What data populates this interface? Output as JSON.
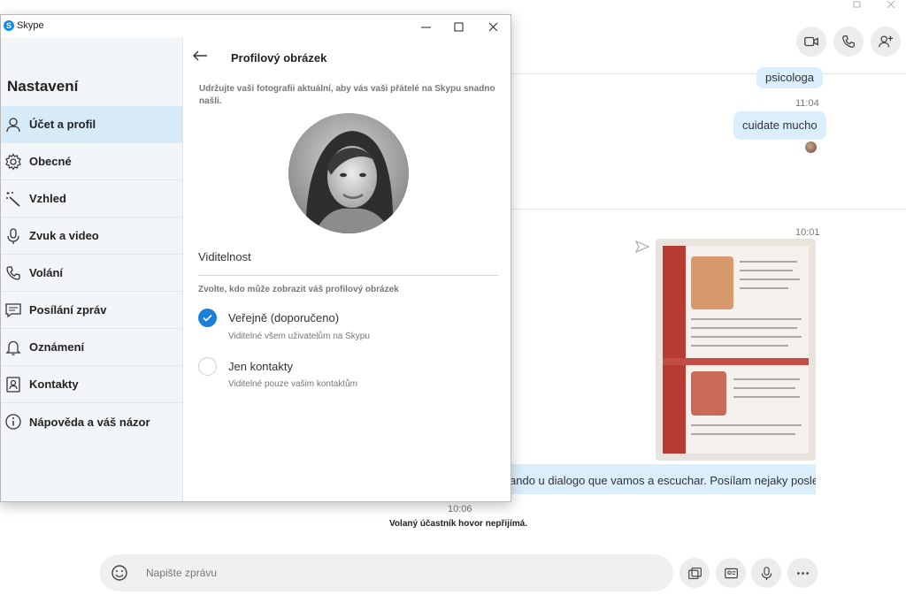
{
  "window": {
    "title": "Skype",
    "logo_letter": "S"
  },
  "settings": {
    "heading": "Nastavení",
    "nav": [
      {
        "label": "Účet a profil",
        "icon": "person-icon",
        "selected": true
      },
      {
        "label": "Obecné",
        "icon": "gear-icon",
        "selected": false
      },
      {
        "label": "Vzhled",
        "icon": "magic-wand-icon",
        "selected": false
      },
      {
        "label": "Zvuk a video",
        "icon": "microphone-icon",
        "selected": false
      },
      {
        "label": "Volání",
        "icon": "phone-icon",
        "selected": false
      },
      {
        "label": "Posílání zpráv",
        "icon": "message-icon",
        "selected": false
      },
      {
        "label": "Oznámení",
        "icon": "bell-icon",
        "selected": false
      },
      {
        "label": "Kontakty",
        "icon": "contact-card-icon",
        "selected": false
      },
      {
        "label": "Nápověda a váš názor",
        "icon": "info-icon",
        "selected": false
      }
    ]
  },
  "profile": {
    "title": "Profilový obrázek",
    "description": "Udržujte vaši fotografii aktuální, aby vás vaši přátelé na Skypu snadno našli.",
    "visibility_heading": "Viditelnost",
    "visibility_sub": "Zvolte, kdo může zobrazit váš profilový obrázek",
    "options": [
      {
        "label": "Veřejně (doporučeno)",
        "desc": "Viditelné všem uživatelům na Skypu",
        "checked": true
      },
      {
        "label": "Jen kontakty",
        "desc": "Viditelné pouze vašim kontaktům",
        "checked": false
      }
    ]
  },
  "chat": {
    "msg_top": "psicologa",
    "time1": "11:04",
    "msg_cuidate": "cuidate mucho",
    "time2": "10:01",
    "msg_long": "ando u dialogo que vamos a escuchar. Posílam nejaky poslech.",
    "time3": "10:06",
    "system_msg": "Volaný účastník hovor nepřijímá.",
    "composer_placeholder": "Napište zprávu"
  },
  "colors": {
    "accent": "#1a7fd6",
    "bubble": "#dbeefc",
    "sidebar": "#f3f6f9",
    "selected_nav": "#d6eaf8"
  }
}
